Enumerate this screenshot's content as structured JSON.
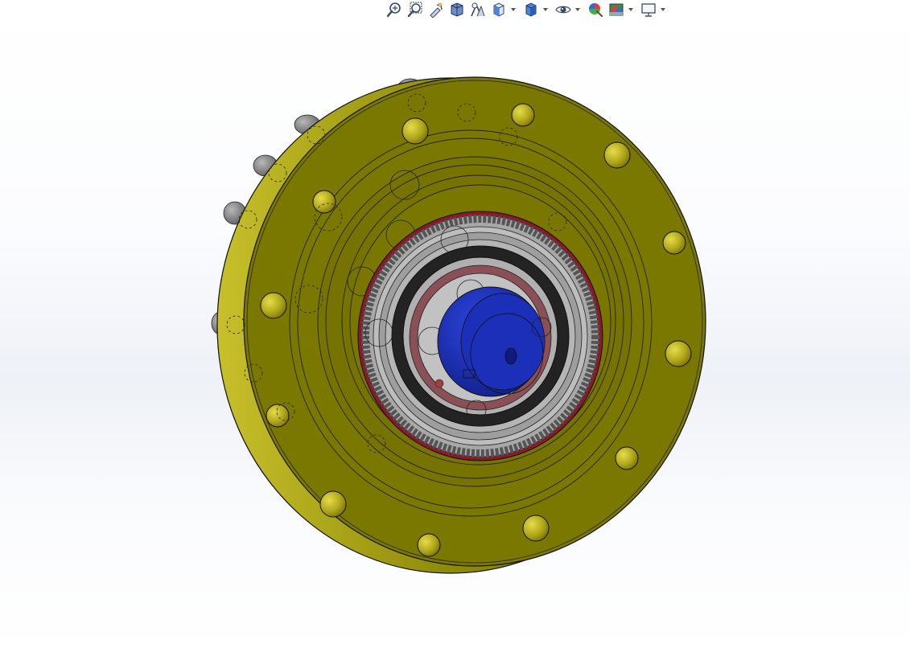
{
  "toolbar": {
    "buttons": [
      {
        "id": "zoom-to-fit",
        "icon": "zoom-to-fit-icon",
        "dropdown": false
      },
      {
        "id": "zoom-to-area",
        "icon": "zoom-to-area-icon",
        "dropdown": false
      },
      {
        "id": "previous-view",
        "icon": "previous-view-icon",
        "dropdown": false
      },
      {
        "id": "section-view",
        "icon": "section-view-icon",
        "dropdown": false
      },
      {
        "id": "dynamic-annotation-views",
        "icon": "dynamic-annotation-icon",
        "dropdown": false
      },
      {
        "id": "view-orientation",
        "icon": "view-orientation-icon",
        "dropdown": true
      },
      {
        "id": "display-style",
        "icon": "display-style-icon",
        "dropdown": true
      },
      {
        "id": "hide-show-items",
        "icon": "hide-show-icon",
        "dropdown": true
      },
      {
        "id": "edit-appearance",
        "icon": "edit-appearance-icon",
        "dropdown": false
      },
      {
        "id": "apply-scene",
        "icon": "apply-scene-icon",
        "dropdown": true
      },
      {
        "id": "view-settings",
        "icon": "monitor-icon",
        "dropdown": true
      }
    ]
  },
  "colors": {
    "housing": "#7a7800",
    "housing_light": "#a7a21a",
    "bolt": "#b5ad22",
    "bearing_gray": "#8c8c8c",
    "seal_red": "#8a1a2a",
    "ring_black": "#222222",
    "shaft_blue": "#1a2fb0",
    "background": "#ffffff"
  }
}
